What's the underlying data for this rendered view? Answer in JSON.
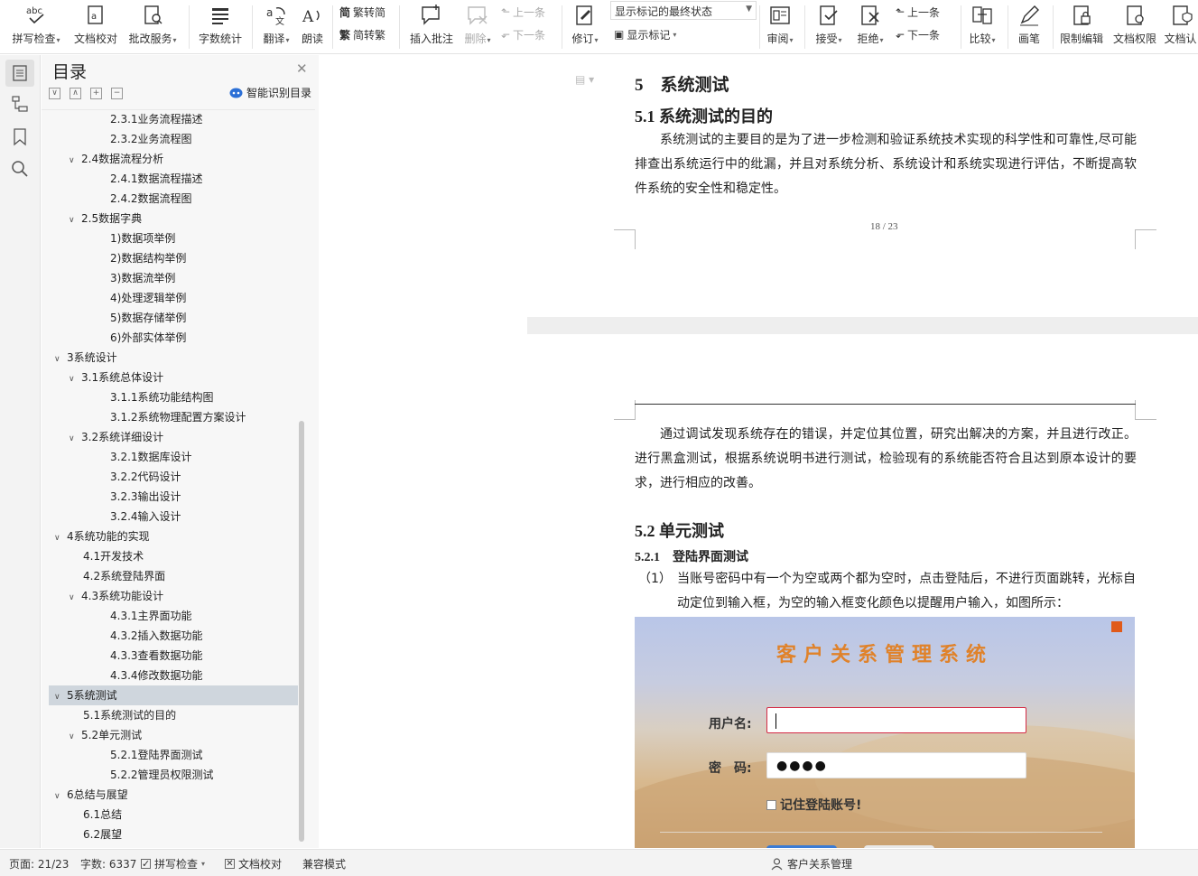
{
  "ribbon": {
    "spellcheck": "拼写检查",
    "doc_proof": "文档校对",
    "batch_service": "批改服务",
    "word_count": "字数统计",
    "translate": "翻译",
    "read_aloud": "朗读",
    "trad_to_simp": "繁转简",
    "simp_to_trad": "简转繁",
    "insert_comment": "插入批注",
    "delete": "删除",
    "prev_comment": "上一条",
    "next_comment": "下一条",
    "revise": "修订",
    "markup_state": "显示标记的最终状态",
    "show_markup": "显示标记",
    "review": "审阅",
    "accept": "接受",
    "reject": "拒绝",
    "prev_change": "上一条",
    "next_change": "下一条",
    "compare": "比较",
    "pen": "画笔",
    "restrict_edit": "限制编辑",
    "doc_permission": "文档权限",
    "doc_cert": "文档认"
  },
  "toc": {
    "title": "目录",
    "smart_label": "智能识别目录",
    "items": [
      {
        "level": 3,
        "label": "2.3.1业务流程描述",
        "chev": ""
      },
      {
        "level": 3,
        "label": "2.3.2业务流程图",
        "chev": ""
      },
      {
        "level": 2,
        "label": "2.4数据流程分析",
        "chev": "∨"
      },
      {
        "level": 3,
        "label": "2.4.1数据流程描述",
        "chev": ""
      },
      {
        "level": 3,
        "label": "2.4.2数据流程图",
        "chev": ""
      },
      {
        "level": 2,
        "label": "2.5数据字典",
        "chev": "∨"
      },
      {
        "level": 3,
        "label": "1)数据项举例",
        "chev": ""
      },
      {
        "level": 3,
        "label": "2)数据结构举例",
        "chev": ""
      },
      {
        "level": 3,
        "label": "3)数据流举例",
        "chev": ""
      },
      {
        "level": 3,
        "label": "4)处理逻辑举例",
        "chev": ""
      },
      {
        "level": 3,
        "label": "5)数据存储举例",
        "chev": ""
      },
      {
        "level": 3,
        "label": "6)外部实体举例",
        "chev": ""
      },
      {
        "level": 1,
        "label": "3系统设计",
        "chev": "∨"
      },
      {
        "level": 2,
        "label": "3.1系统总体设计",
        "chev": "∨"
      },
      {
        "level": 3,
        "label": "3.1.1系统功能结构图",
        "chev": ""
      },
      {
        "level": 3,
        "label": "3.1.2系统物理配置方案设计",
        "chev": ""
      },
      {
        "level": 2,
        "label": "3.2系统详细设计",
        "chev": "∨"
      },
      {
        "level": 3,
        "label": "3.2.1数据库设计",
        "chev": ""
      },
      {
        "level": 3,
        "label": "3.2.2代码设计",
        "chev": ""
      },
      {
        "level": 3,
        "label": "3.2.3输出设计",
        "chev": ""
      },
      {
        "level": 3,
        "label": "3.2.4输入设计",
        "chev": ""
      },
      {
        "level": 1,
        "label": "4系统功能的实现",
        "chev": "∨"
      },
      {
        "level": 2,
        "label": "4.1开发技术",
        "chev": ""
      },
      {
        "level": 2,
        "label": "4.2系统登陆界面",
        "chev": ""
      },
      {
        "level": 2,
        "label": "4.3系统功能设计",
        "chev": "∨"
      },
      {
        "level": 3,
        "label": "4.3.1主界面功能",
        "chev": ""
      },
      {
        "level": 3,
        "label": "4.3.2插入数据功能",
        "chev": ""
      },
      {
        "level": 3,
        "label": "4.3.3查看数据功能",
        "chev": ""
      },
      {
        "level": 3,
        "label": "4.3.4修改数据功能",
        "chev": ""
      },
      {
        "level": 1,
        "label": "5系统测试",
        "chev": "∨"
      },
      {
        "level": 2,
        "label": "5.1系统测试的目的",
        "chev": ""
      },
      {
        "level": 2,
        "label": "5.2单元测试",
        "chev": "∨"
      },
      {
        "level": 3,
        "label": "5.2.1登陆界面测试",
        "chev": ""
      },
      {
        "level": 3,
        "label": "5.2.2管理员权限测试",
        "chev": ""
      },
      {
        "level": 1,
        "label": "6总结与展望",
        "chev": "∨"
      },
      {
        "level": 2,
        "label": "6.1总结",
        "chev": ""
      },
      {
        "level": 2,
        "label": "6.2展望",
        "chev": ""
      }
    ],
    "selected_label": "5系统测试"
  },
  "doc": {
    "h1": "5　系统测试",
    "h2_1": "5.1 系统测试的目的",
    "p1": "系统测试的主要目的是为了进一步检测和验证系统技术实现的科学性和可靠性,尽可能排查出系统运行中的纰漏，并且对系统分析、系统设计和系统实现进行评估，不断提高软件系统的安全性和稳定性。",
    "page_number": "18 / 23",
    "p2": "通过调试发现系统存在的错误，并定位其位置，研究出解决的方案，并且进行改正。进行黑盒测试，根据系统说明书进行测试，检验现有的系统能否符合且达到原本设计的要求，进行相应的改善。",
    "h2_2": "5.2 单元测试",
    "h3_1": "5.2.1　登陆界面测试",
    "list_num": "（1）",
    "list_text": "当账号密码中有一个为空或两个都为空时，点击登陆后，不进行页面跳转，光标自动定位到输入框，为空的输入框变化颜色以提醒用户输入，如图所示："
  },
  "login_figure": {
    "title": "客户关系管理系统",
    "user_label": "用户名:",
    "pwd_label": "密　码:",
    "pwd_mask": "●●●●",
    "remember": "记住登陆账号!"
  },
  "status": {
    "page": "页面: 21/23",
    "words": "字数: 6337",
    "spellcheck": "拼写检查",
    "doc_proof": "文档校对",
    "compat": "兼容模式",
    "center_title": "客户关系管理"
  },
  "colors": {
    "accent_blue": "#2b6fd6",
    "selected_toc": "#cfd6dd",
    "login_title": "#e0822a",
    "error_border": "#d42b45"
  }
}
